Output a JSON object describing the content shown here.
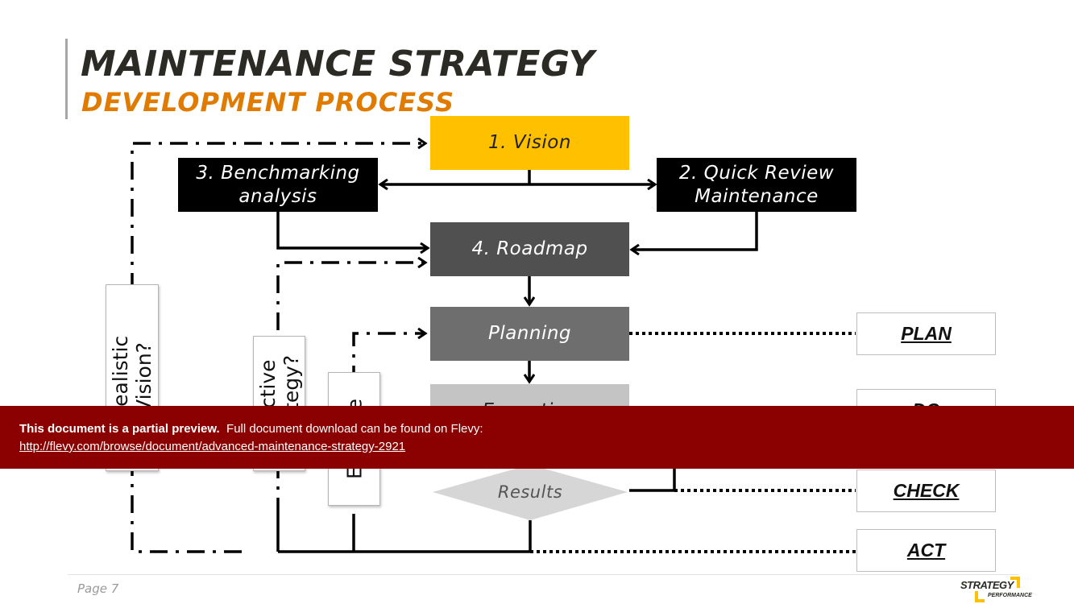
{
  "header": {
    "title": "MAINTENANCE STRATEGY",
    "subtitle": "DEVELOPMENT PROCESS"
  },
  "colors": {
    "accent_orange": "#e07b00",
    "vision_yellow": "#ffc000",
    "banner_red": "#8b0000",
    "roadmap_gray": "#505050",
    "planning_gray": "#6e6e6e",
    "execution_gray": "#c4c4c4",
    "results_gray": "#d6d6d6"
  },
  "diagram": {
    "nodes": {
      "vision": "1. Vision",
      "quick_review": "2. Quick Review\nMaintenance",
      "benchmarking": "3. Benchmarking\nanalysis",
      "roadmap": "4. Roadmap",
      "planning": "Planning",
      "execution": "Execution",
      "results": "Results"
    },
    "feedback_labels": {
      "realistic_vision": "Realistic\nVision?",
      "effective_strategy": "Effective\nStrategy?",
      "execute": "Execute"
    },
    "pdca": [
      "PLAN",
      "DO",
      "CHECK",
      "ACT"
    ]
  },
  "banner": {
    "bold_text": "This document is a partial preview.",
    "text": "Full document download can be found on Flevy:",
    "link": "http://flevy.com/browse/document/advanced-maintenance-strategy-2921"
  },
  "footer": {
    "page": "Page 7",
    "logo_top": "STRATEGY",
    "logo_bottom": "PERFORMANCE"
  }
}
